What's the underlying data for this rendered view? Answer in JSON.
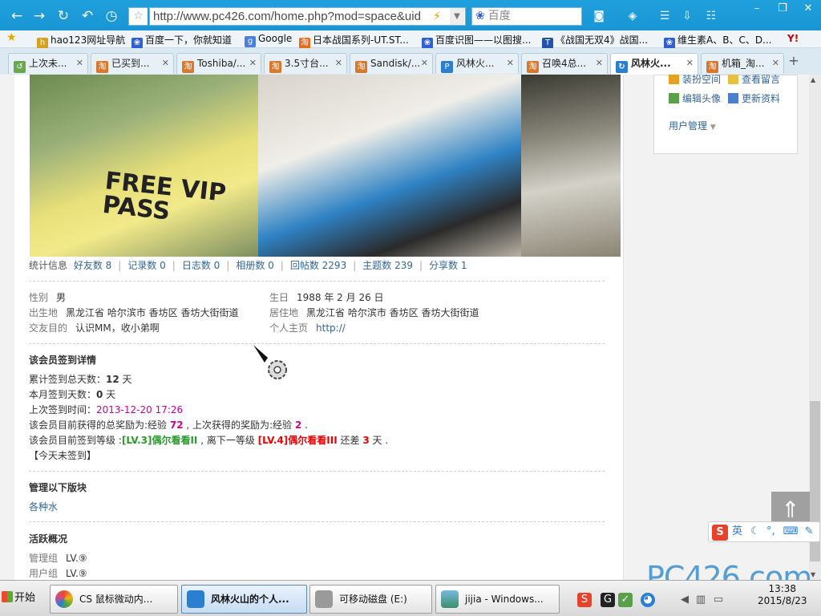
{
  "browser": {
    "url": "http://www.pc426.com/home.php?mod=space&uid",
    "search_placeholder": "百度",
    "nav_icons": [
      "back-icon",
      "forward-icon",
      "refresh-icon",
      "undo-icon",
      "history-icon"
    ],
    "bookmarks": [
      {
        "label": "hao123网址导航",
        "icon": "hao123-icon",
        "color": "#d8a020"
      },
      {
        "label": "百度一下，你就知道",
        "icon": "baidu-paw-icon",
        "color": "#2f5fd0"
      },
      {
        "label": "Google",
        "icon": "google-icon",
        "color": "#4a7fe0"
      },
      {
        "label": "日本战国系列-UT.ST...",
        "icon": "taobao-icon",
        "color": "#e86a1a"
      },
      {
        "label": "百度识图——以图搜...",
        "icon": "baidu-paw-icon",
        "color": "#2f5fd0"
      },
      {
        "label": "《战国无双4》战国...",
        "icon": "tg-icon",
        "color": "#2255aa"
      },
      {
        "label": "维生素A、B、C、D...",
        "icon": "baidu-paw-icon",
        "color": "#2f5fd0"
      }
    ],
    "tabs": [
      {
        "label": "上次未...",
        "active": false
      },
      {
        "label": "已买到...",
        "active": false
      },
      {
        "label": "Toshiba/...",
        "active": false
      },
      {
        "label": "3.5寸台...",
        "active": false
      },
      {
        "label": "Sandisk/...",
        "active": false
      },
      {
        "label": "风林火...",
        "active": false
      },
      {
        "label": "召唤4总...",
        "active": false
      },
      {
        "label": "风林火...",
        "active": true
      },
      {
        "label": "机箱_淘...",
        "active": false
      }
    ]
  },
  "stats": {
    "title": "统计信息",
    "items": [
      {
        "label": "好友数 8"
      },
      {
        "label": "记录数 0"
      },
      {
        "label": "日志数 0"
      },
      {
        "label": "相册数 0"
      },
      {
        "label": "回帖数 2293"
      },
      {
        "label": "主题数 239"
      },
      {
        "label": "分享数 1"
      }
    ]
  },
  "profile": {
    "gender_k": "性别",
    "gender_v": "男",
    "birthday_k": "生日",
    "birthday_v": "1988 年 2 月 26 日",
    "birthplace_k": "出生地",
    "birthplace_v": "黑龙江省 哈尔滨市 香坊区 香坊大街街道",
    "residence_k": "居住地",
    "residence_v": "黑龙江省 哈尔滨市 香坊区 香坊大街街道",
    "purpose_k": "交友目的",
    "purpose_v": "认识MM，收小弟啊",
    "homepage_k": "个人主页",
    "homepage_v": "http://"
  },
  "signin": {
    "title": "该会员签到详情",
    "total_prefix": "累计签到总天数：",
    "total_days": "12",
    "day_unit": " 天",
    "month_prefix": "本月签到天数：",
    "month_days": "0",
    "last_prefix": "上次签到时间：",
    "last_time": "2013-12-20 17:26",
    "reward_a": "该会员目前获得的总奖励为:经验 ",
    "reward_total": "72",
    "reward_b": " , 上次获得的奖励为:经验 ",
    "reward_last": "2",
    "reward_end": " .",
    "level_a": "该会员目前签到等级 :",
    "level_cur": "[LV.3]偶尔看看II",
    "level_b": " , 离下一等级 ",
    "level_next": "[LV.4]偶尔看看III",
    "level_c": " 还差 ",
    "level_gap": "3",
    "level_d": " 天 .",
    "today": "【今天未签到】"
  },
  "manage": {
    "title": "管理以下版块",
    "board": "各种水"
  },
  "activity": {
    "title": "活跃概况",
    "admin_k": "管理组",
    "admin_v": "LV.⑨",
    "user_k": "用户组",
    "user_v": "LV.⑨"
  },
  "sidebar": {
    "decorate": "装扮空间",
    "messages": "查看留言",
    "edit_avatar": "编辑头像",
    "update_profile": "更新资料",
    "user_manage": "用户管理"
  },
  "ime": {
    "lang": "英"
  },
  "taskbar": {
    "start": "开始",
    "items": [
      {
        "label": "CS  鼠标微动内...",
        "active": false,
        "color": "#d04a8a"
      },
      {
        "label": "风林火山的个人...",
        "active": true,
        "color": "#2a7fd0"
      },
      {
        "label": "可移动磁盘 (E:)",
        "active": false,
        "color": "#999999"
      },
      {
        "label": "jijia - Windows...",
        "active": false,
        "color": "#3a8f6a"
      }
    ],
    "time": "13:38",
    "date": "2015/8/23"
  },
  "watermark": "PC426.com",
  "photo_text": "FREE VIP PASS"
}
